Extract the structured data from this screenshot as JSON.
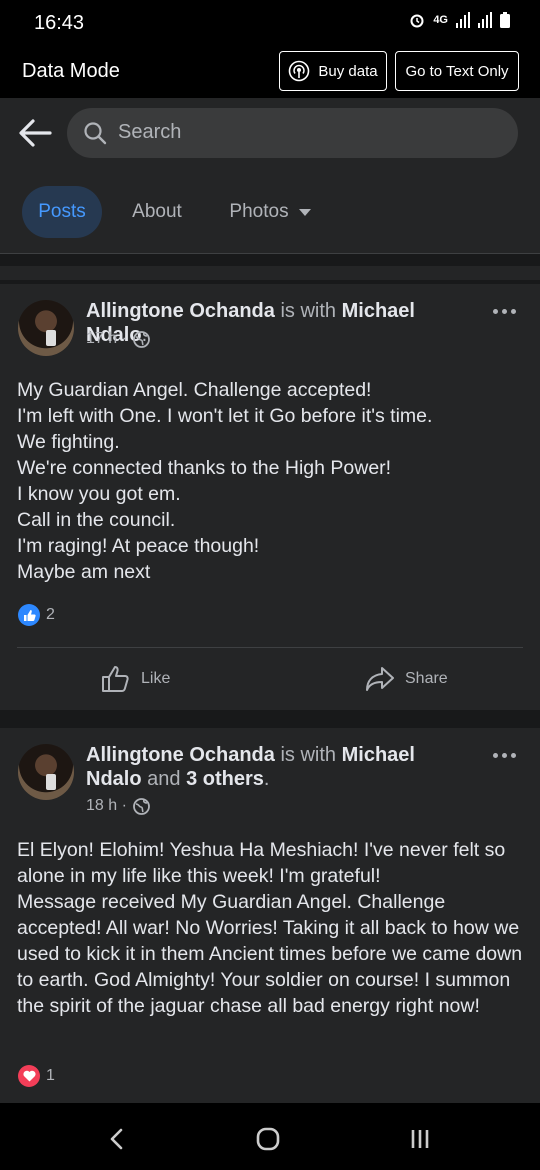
{
  "status_bar": {
    "time": "16:43",
    "network": "4G"
  },
  "data_mode": {
    "label": "Data Mode",
    "buy_data": "Buy data",
    "text_only": "Go to Text Only"
  },
  "search": {
    "placeholder": "Search"
  },
  "tabs": [
    {
      "label": "Posts",
      "active": true
    },
    {
      "label": "About",
      "active": false
    },
    {
      "label": "Photos",
      "active": false
    }
  ],
  "posts": [
    {
      "author": "Allingtone Ochanda",
      "with_text": "is with",
      "tagged": "Michael Ndalo",
      "tail": ".",
      "time": "17 h ·",
      "text": "My Guardian Angel. Challenge accepted!\nI'm left with One. I won't let it Go before it's time.\nWe fighting.\nWe're connected thanks to the High Power!\nI know you got em.\nCall in the council.\nI'm raging! At peace though!\nMaybe am next",
      "reaction_count": "2",
      "reaction_icon": "like-icon",
      "like_label": "Like",
      "share_label": "Share"
    },
    {
      "author": "Allingtone Ochanda",
      "with_text": "is with",
      "tagged": "Michael Ndalo",
      "and_text": "and",
      "others": "3 others",
      "tail": ".",
      "time": "18 h ·",
      "text": "El Elyon! Elohim! Yeshua Ha Meshiach! I've never felt so alone in my life like this week! I'm grateful!\nMessage received My Guardian Angel. Challenge accepted! All war! No Worries! Taking it all back to how we used to kick it in them Ancient times before we came down to earth. God Almighty! Your soldier on course! I summon the spirit of the jaguar chase all bad energy right now!",
      "reaction_count": "1",
      "reaction_icon": "love-icon"
    }
  ],
  "colors": {
    "accent": "#4599ff",
    "like_blue": "#2d88ff",
    "love_red": "#f33e58"
  }
}
